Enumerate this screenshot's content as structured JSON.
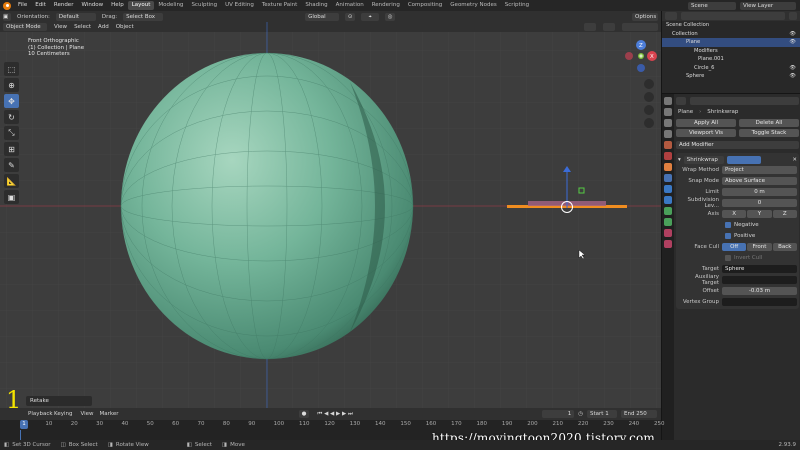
{
  "menu": {
    "items": [
      "File",
      "Edit",
      "Render",
      "Window",
      "Help"
    ],
    "workspaces": [
      "Layout",
      "Modeling",
      "Sculpting",
      "UV Editing",
      "Texture Paint",
      "Shading",
      "Animation",
      "Rendering",
      "Compositing",
      "Geometry Nodes",
      "Scripting"
    ],
    "active_workspace": "Layout",
    "scene": "Scene",
    "view_layer": "View Layer"
  },
  "tool_header": {
    "orientation_label": "Orientation:",
    "orientation_value": "Default",
    "drag_label": "Drag:",
    "drag_value": "Select Box",
    "transform_space": "Global",
    "options": "Options"
  },
  "viewport_header": {
    "mode": "Object Mode",
    "menus": [
      "View",
      "Select",
      "Add",
      "Object"
    ]
  },
  "viewport_info": {
    "line1": "Front Orthographic",
    "line2": "(1) Collection | Plane",
    "line3": "10 Centimeters"
  },
  "outliner": {
    "rows": [
      {
        "label": "Scene Collection",
        "indent": 0,
        "selected": false
      },
      {
        "label": "Collection",
        "indent": 1,
        "selected": false
      },
      {
        "label": "Plane",
        "indent": 2,
        "selected": true
      },
      {
        "label": "Modifiers",
        "indent": 3,
        "selected": false
      },
      {
        "label": "Plane.001",
        "indent": 3,
        "selected": false
      },
      {
        "label": "Circle_6",
        "indent": 3,
        "selected": false
      },
      {
        "label": "Sphere",
        "indent": 2,
        "selected": false
      }
    ]
  },
  "properties": {
    "object_name": "Plane",
    "modifier_name_top": "Shrinkwrap",
    "apply_all": "Apply All",
    "delete_all": "Delete All",
    "viewport_vis": "Viewport Vis",
    "toggle_stack": "Toggle Stack",
    "add_modifier": "Add Modifier",
    "modifier_panel_name": "Shrinkwrap",
    "wrap_method_label": "Wrap Method",
    "wrap_method_value": "Project",
    "snap_mode_label": "Snap Mode",
    "snap_mode_value": "Above Surface",
    "limit_label": "Limit",
    "limit_value": "0 m",
    "subdiv_label": "Subdivision Lev...",
    "subdiv_value": "0",
    "axis_label": "Axis",
    "axis_x": "X",
    "axis_y": "Y",
    "axis_z": "Z",
    "negative_label": "Negative",
    "positive_label": "Positive",
    "face_cull_label": "Face Cull",
    "face_cull_off": "Off",
    "face_cull_front": "Front",
    "face_cull_back": "Back",
    "invert_cull": "Invert Cull",
    "target_label": "Target",
    "target_value": "Sphere",
    "aux_target_label": "Auxiliary Target",
    "offset_label": "Offset",
    "offset_value": "-0.03 m",
    "vertex_group_label": "Vertex Group"
  },
  "timeline": {
    "menus": [
      "Playback",
      "Keying",
      "View",
      "Marker"
    ],
    "current_frame": "1",
    "start_label": "Start",
    "start_value": "1",
    "end_label": "End",
    "end_value": "250",
    "ticks": [
      "0",
      "20",
      "40",
      "60",
      "80",
      "100",
      "120",
      "140",
      "160",
      "180",
      "200",
      "220",
      "240"
    ],
    "visible_ticks": [
      "1",
      "10",
      "20",
      "30",
      "40",
      "50",
      "60",
      "70",
      "80",
      "90",
      "100",
      "110",
      "120",
      "130",
      "140",
      "150",
      "160",
      "170",
      "180",
      "190",
      "200",
      "210",
      "220",
      "230",
      "240",
      "250"
    ]
  },
  "retake_panel": "Retake",
  "statusbar": {
    "items": [
      "Set 3D Cursor",
      "Box Select",
      "Rotate View",
      "Select",
      "Move"
    ],
    "version": "2.93.9"
  },
  "watermark": "https://movingtoon2020.tistory.com",
  "step_number": "1",
  "colors": {
    "sphere": "#6bae93",
    "accent_blue": "#4772b3",
    "x_axis": "#a33e48",
    "z_axis": "#3a5ba8",
    "plane_highlight": "#f08d20"
  }
}
